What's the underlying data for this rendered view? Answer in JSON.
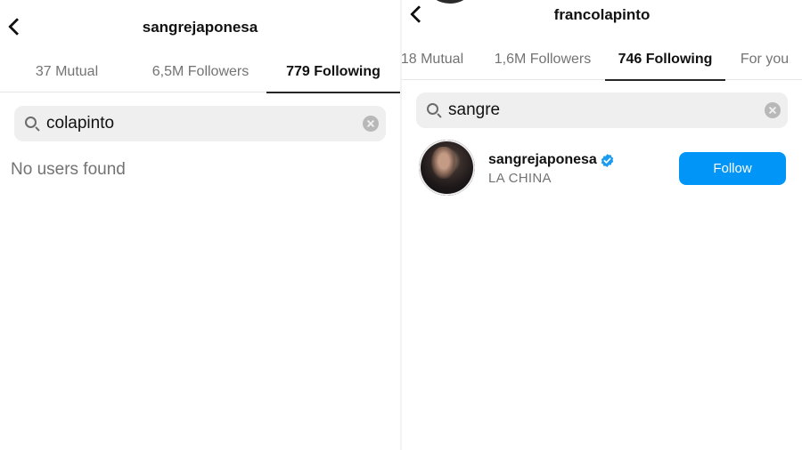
{
  "left": {
    "username": "sangrejaponesa",
    "tabs": [
      {
        "label": "37 Mutual"
      },
      {
        "label": "6,5M Followers"
      },
      {
        "label": "779 Following"
      }
    ],
    "active_tab": "779 Following",
    "search": {
      "value": "colapinto"
    },
    "empty_message": "No users found"
  },
  "right": {
    "username": "francolapinto",
    "tabs": [
      {
        "label": "18 Mutual"
      },
      {
        "label": "1,6M Followers"
      },
      {
        "label": "746 Following"
      },
      {
        "label": "For you"
      }
    ],
    "active_tab": "746 Following",
    "search": {
      "value": "sangre"
    },
    "result": {
      "username": "sangrejaponesa",
      "verified": true,
      "full_name": "LA CHINA",
      "button_label": "Follow"
    }
  },
  "colors": {
    "accent": "#0095f6",
    "text_primary": "#111111",
    "text_secondary": "#737373",
    "search_bg": "#efefef",
    "verified": "#1d9bf0"
  },
  "icons": [
    "chevron-left-icon",
    "search-icon",
    "clear-icon",
    "verified-badge-icon"
  ]
}
